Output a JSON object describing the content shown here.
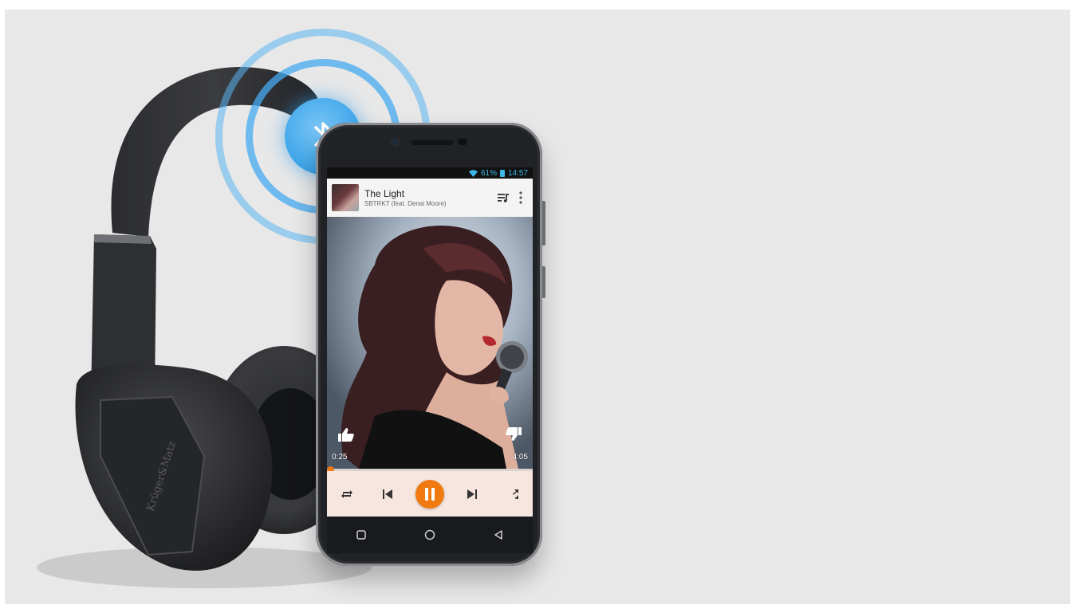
{
  "status_bar": {
    "battery": "61%",
    "time": "14:57",
    "wifi_icon": "wifi-icon",
    "battery_icon": "battery-icon"
  },
  "now_playing": {
    "title": "The Light",
    "artist": "SBTRKT (feat. Denai Moore)",
    "queue_icon": "queue-music-icon",
    "menu_icon": "more-vert-icon"
  },
  "player": {
    "elapsed": "0:25",
    "duration": "4:05",
    "progress_fraction": 0.0,
    "thumbs_up_icon": "thumb-up-icon",
    "thumbs_down_icon": "thumb-down-icon",
    "controls": [
      "repeat-icon",
      "skip-previous-icon",
      "pause-icon",
      "skip-next-icon",
      "shuffle-icon"
    ]
  },
  "nav_bar": [
    "overview-square-icon",
    "home-circle-icon",
    "back-triangle-icon"
  ],
  "headphones_brand": "Krüger&Matz",
  "colors": {
    "accent": "#f07a10",
    "bluetooth": "#3fa6ea",
    "status_text": "#3fb6e8",
    "background": "#e8e8e8"
  }
}
